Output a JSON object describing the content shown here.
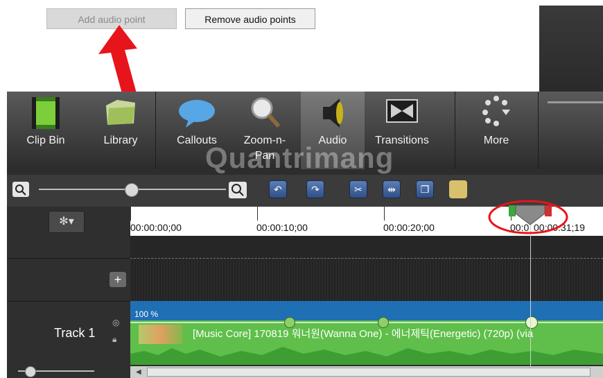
{
  "top_panel": {
    "add_audio_point": "Add audio point",
    "remove_audio_points": "Remove audio points"
  },
  "toolbar": {
    "tools": [
      {
        "label": "Clip Bin",
        "icon": "film-strip-icon"
      },
      {
        "label": "Library",
        "icon": "library-folder-icon"
      },
      {
        "label": "Callouts",
        "icon": "speech-bubble-icon"
      },
      {
        "label": "Zoom-n-Pan",
        "icon": "magnifier-icon"
      },
      {
        "label": "Audio",
        "icon": "speaker-icon"
      },
      {
        "label": "Transitions",
        "icon": "transitions-icon"
      },
      {
        "label": "More",
        "icon": "more-dots-icon"
      }
    ]
  },
  "watermark": "Quantrimang",
  "timeline": {
    "timecodes": [
      "00:00:00;00",
      "00:00:10;00",
      "00:00:20;00",
      "00:0",
      "00:00:31;19"
    ],
    "track_label": "Track 1",
    "clip_volume": "100 %",
    "clip_title": "[Music Core] 170819 워너원(Wanna One) - 에너제틱(Energetic) (720p) (via"
  },
  "colors": {
    "annotation_red": "#e8141b",
    "clip_blue": "#1f6fb5",
    "clip_green": "#5fbf4a",
    "toolbar_dark": "#2c2c2c"
  }
}
